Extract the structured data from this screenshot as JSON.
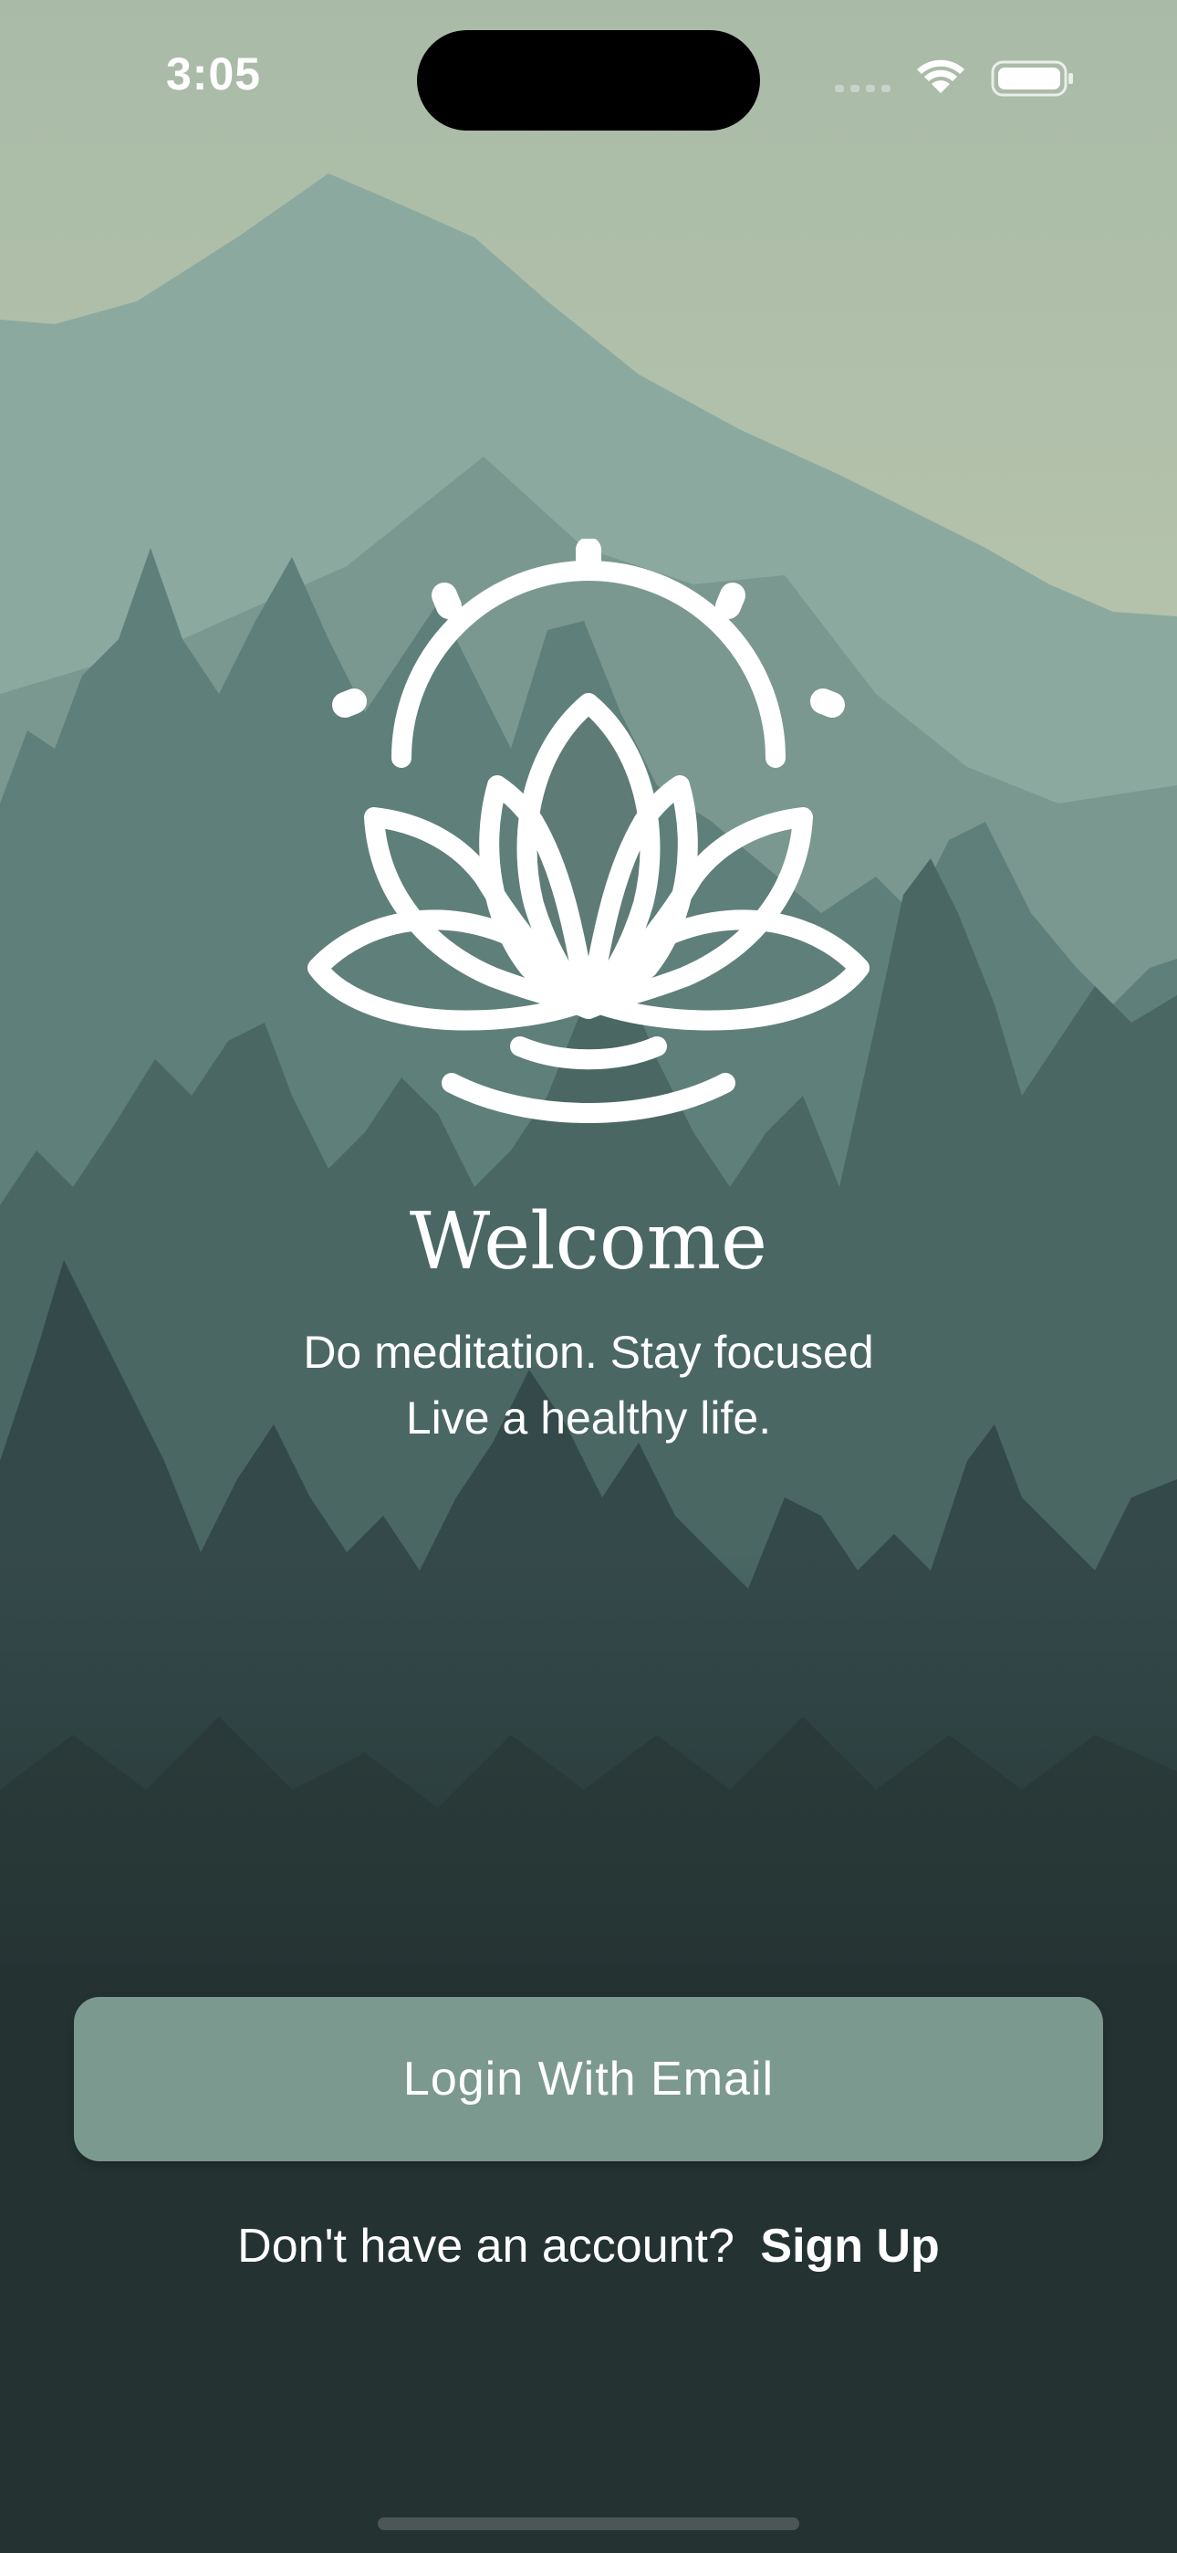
{
  "status_bar": {
    "time": "3:05"
  },
  "welcome": {
    "title": "Welcome",
    "subtitle_line1": "Do meditation. Stay focused",
    "subtitle_line2": "Live a healthy life."
  },
  "actions": {
    "login_label": "Login With Email",
    "signup_prompt": "Don't have an account?",
    "signup_label": "Sign Up"
  },
  "icons": {
    "logo": "lotus-sun-icon",
    "wifi": "wifi-icon",
    "battery": "battery-icon",
    "signal": "cellular-signal-icon"
  },
  "colors": {
    "button": "#7c9990",
    "background_dark": "#243332",
    "sky_top": "#a9bba7",
    "sky_glow": "#d7d8b8"
  }
}
